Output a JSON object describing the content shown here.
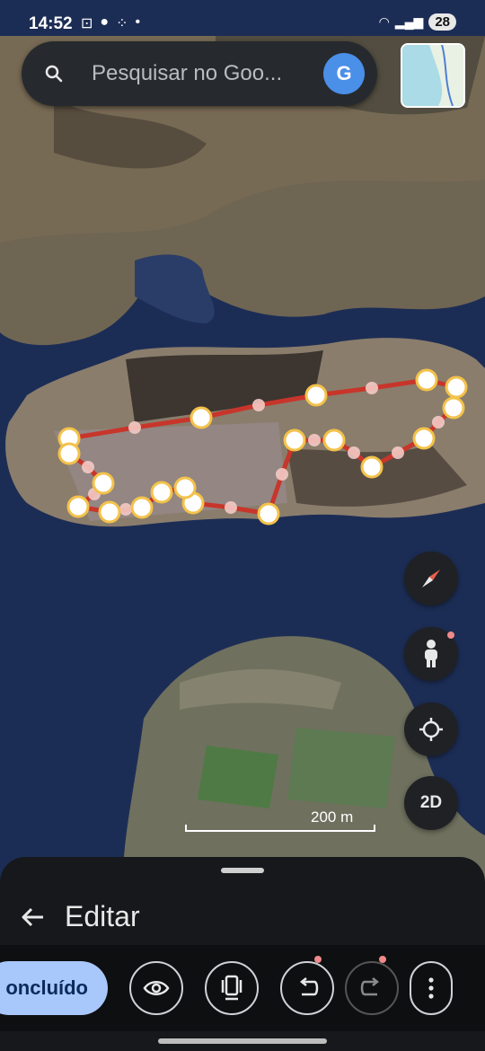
{
  "status": {
    "time": "14:52",
    "battery": "28"
  },
  "search": {
    "placeholder": "Pesquisar no Goo...",
    "avatar_letter": "G"
  },
  "map": {
    "scale_label": "200 m",
    "mode_button": "2D"
  },
  "sheet": {
    "title": "Editar",
    "done_label": "oncluído"
  },
  "colors": {
    "path": "#c8352b",
    "node_fill": "#ffffff",
    "node_ring": "#f3c24a",
    "accent": "#a8c7fa"
  },
  "icons": [
    "search-icon",
    "compass-icon",
    "pegman-icon",
    "my-location-icon",
    "back-arrow-icon",
    "eye-icon",
    "layers-icon",
    "undo-icon",
    "redo-icon",
    "more-vert-icon"
  ]
}
